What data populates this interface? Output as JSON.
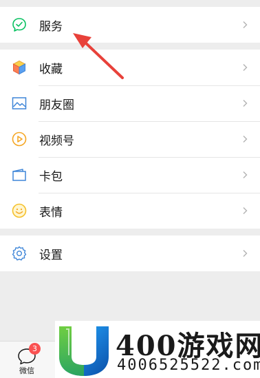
{
  "menu": {
    "group1": [
      {
        "label": "服务",
        "icon": "service-icon"
      }
    ],
    "group2": [
      {
        "label": "收藏",
        "icon": "favorites-cube-icon"
      },
      {
        "label": "朋友圈",
        "icon": "moments-image-icon"
      },
      {
        "label": "视频号",
        "icon": "channels-play-icon"
      },
      {
        "label": "卡包",
        "icon": "card-wallet-icon"
      },
      {
        "label": "表情",
        "icon": "sticker-smile-icon"
      }
    ],
    "group3": [
      {
        "label": "设置",
        "icon": "settings-gear-icon"
      }
    ]
  },
  "tabbar": {
    "chats_label": "微信",
    "chats_badge": "3"
  },
  "watermark": {
    "brand": "400游戏网",
    "phone": "4006525522.com"
  },
  "colors": {
    "accent_green": "#07c160",
    "badge_red": "#fa5151",
    "arrow_red": "#e8413a",
    "background": "#ededed"
  }
}
